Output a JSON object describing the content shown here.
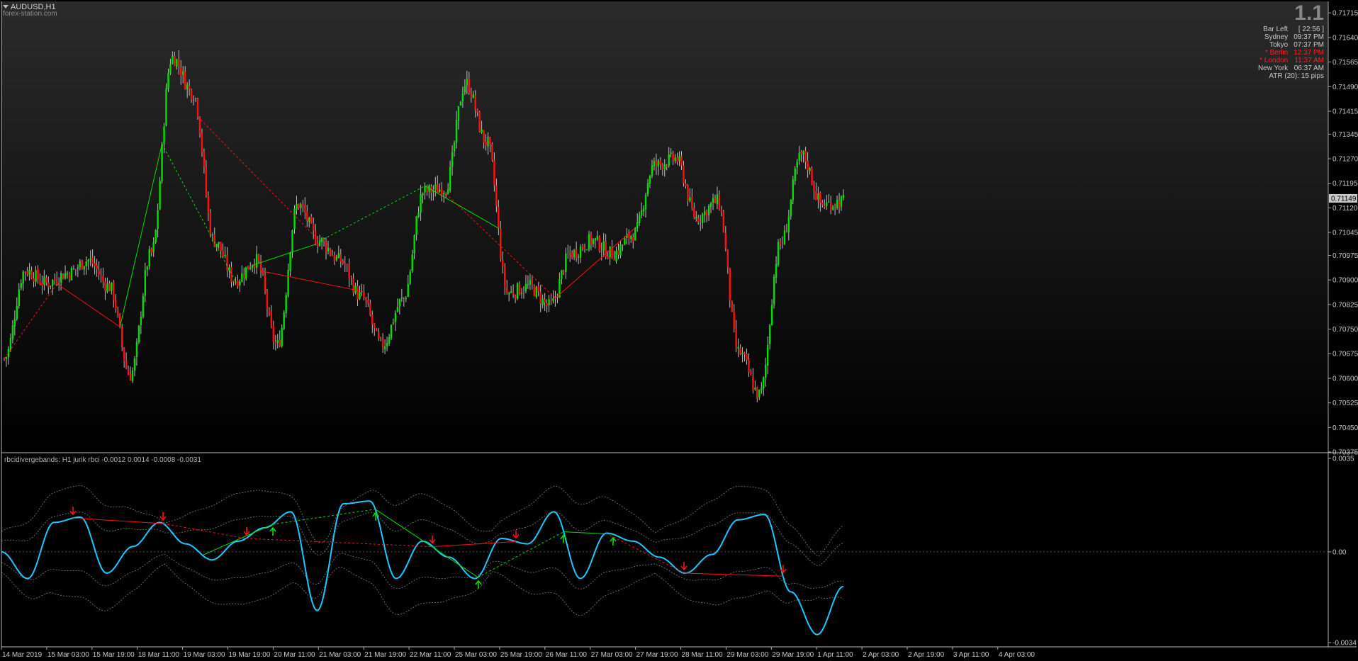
{
  "chart_title": "AUDUSD,H1",
  "watermark": "forex-station.com",
  "spread_value": "1.1",
  "sessions": [
    {
      "label": "Bar Left",
      "value": "[ 22:56 ]",
      "color": "#c8c8c8"
    },
    {
      "label": "Sydney",
      "value": "09:37 PM",
      "color": "#c8c8c8"
    },
    {
      "label": "Tokyo",
      "value": "07:37 PM",
      "color": "#c8c8c8"
    },
    {
      "label": "* Berlin",
      "value": "12:37 PM",
      "color": "#ff2020"
    },
    {
      "label": "* London",
      "value": "11:37 AM",
      "color": "#ff2020"
    },
    {
      "label": "New York",
      "value": "06:37 AM",
      "color": "#c8c8c8"
    }
  ],
  "atr_text": "ATR (20): 15 pips",
  "current_price": "0.71149",
  "indicator_title": "rbcidivergebands: H1  jurik rbci -0.0012 0.0014 -0.0008 -0.0031",
  "colors": {
    "bull": "#00e000",
    "bear": "#ff1010",
    "osc": "#1ec8ff",
    "band": "#808080",
    "grid": "#3a3a3a"
  },
  "chart_data": [
    {
      "type": "candlestick",
      "ylim": [
        0.70375,
        0.7175
      ],
      "yticks": [
        "0.71715",
        "0.71640",
        "0.71565",
        "0.71490",
        "0.71415",
        "0.71345",
        "0.71270",
        "0.71195",
        "0.71120",
        "0.71045",
        "0.70975",
        "0.70900",
        "0.70825",
        "0.70750",
        "0.70675",
        "0.70600",
        "0.70525",
        "0.70450",
        "0.70375"
      ],
      "xticks": [
        "14 Mar 2019",
        "15 Mar 03:00",
        "15 Mar 19:00",
        "18 Mar 11:00",
        "19 Mar 03:00",
        "19 Mar 19:00",
        "20 Mar 11:00",
        "21 Mar 03:00",
        "21 Mar 19:00",
        "22 Mar 11:00",
        "25 Mar 03:00",
        "25 Mar 19:00",
        "26 Mar 11:00",
        "27 Mar 03:00",
        "27 Mar 19:00",
        "28 Mar 11:00",
        "29 Mar 03:00",
        "29 Mar 19:00",
        "1 Apr 11:00",
        "2 Apr 03:00",
        "2 Apr 19:00",
        "3 Apr 11:00",
        "4 Apr 03:00"
      ],
      "anchors": [
        0.7066,
        0.7093,
        0.7089,
        0.7092,
        0.7096,
        0.7088,
        0.7061,
        0.7098,
        0.7158,
        0.7147,
        0.7102,
        0.709,
        0.7096,
        0.707,
        0.7113,
        0.7102,
        0.7096,
        0.7085,
        0.707,
        0.7084,
        0.7117,
        0.7118,
        0.715,
        0.7132,
        0.7086,
        0.7088,
        0.7082,
        0.7098,
        0.7102,
        0.7098,
        0.7104,
        0.7125,
        0.7127,
        0.7109,
        0.7114,
        0.7068,
        0.7055,
        0.7101,
        0.7128,
        0.7113,
        0.7114
      ],
      "prices": [
        {
          "label": "Bar Left",
          "value": "[ 22:56 ]"
        }
      ]
    },
    {
      "type": "line",
      "name": "jurik rbci",
      "ylim": [
        -0.0034,
        0.0035
      ],
      "yticks": [
        "0.0035",
        "0.00",
        "-0.0034"
      ],
      "osc_anchors": [
        0.0,
        -0.001,
        0.0011,
        0.0013,
        -0.0008,
        0.0002,
        0.0011,
        0.0003,
        -0.0003,
        0.0004,
        0.0009,
        0.0015,
        -0.0022,
        0.0018,
        0.0019,
        -0.001,
        0.0004,
        -0.0002,
        -0.001,
        0.0005,
        0.0003,
        0.0015,
        -0.001,
        0.0007,
        0.0004,
        -0.0002,
        -0.0008,
        -0.0001,
        0.0012,
        0.0014,
        -0.0015,
        -0.0031,
        -0.0013
      ]
    }
  ]
}
